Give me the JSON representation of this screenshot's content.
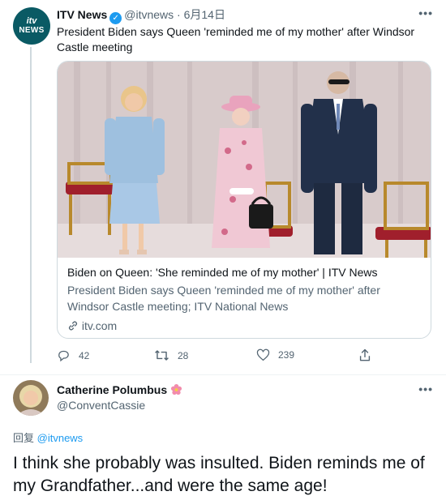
{
  "tweet": {
    "avatar": {
      "line1": "itv",
      "line2": "NEWS"
    },
    "author_name": "ITV News",
    "author_handle": "@itvnews",
    "date": "· 6月14日",
    "text": "President Biden says Queen 'reminded me of my mother' after Windsor Castle meeting",
    "card": {
      "title": "Biden on Queen: 'She reminded me of my mother' | ITV News",
      "description": "President Biden says Queen 'reminded me of my mother' after Windsor Castle meeting; ITV National News",
      "domain": "itv.com"
    },
    "actions": {
      "replies": "42",
      "retweets": "28",
      "likes": "239"
    }
  },
  "reply": {
    "author_name": "Catherine Polumbus",
    "author_handle": "@ConventCassie",
    "replying_prefix": "回复",
    "replying_to": "@itvnews",
    "text": "I think she probably was insulted. Biden reminds me of my Grandfather...and were the same age!"
  },
  "more_label": "•••",
  "colors": {
    "accent": "#1d9bf0",
    "muted": "#536471",
    "border": "#cfd9de",
    "itv_teal": "#0a5a64"
  }
}
